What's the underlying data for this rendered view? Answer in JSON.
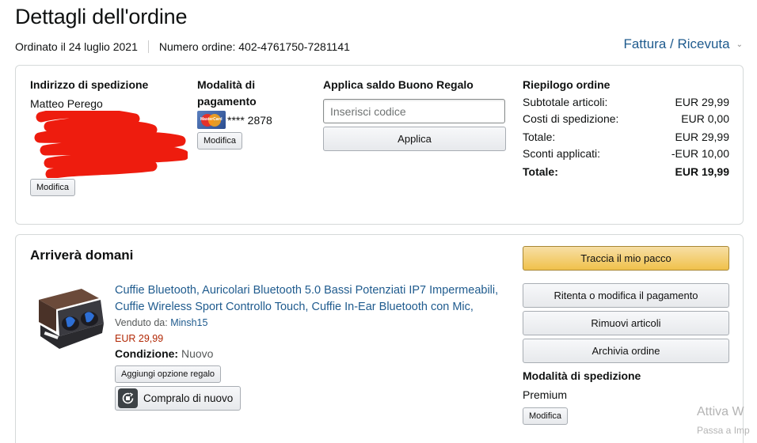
{
  "header": {
    "title": "Dettagli dell'ordine",
    "ordered_on": "Ordinato il 24 luglio 2021",
    "order_number": "Numero ordine: 402-4761750-7281141",
    "invoice_link": "Fattura / Ricevuta"
  },
  "shipping_address": {
    "heading": "Indirizzo di spedizione",
    "name": "Matteo Perego",
    "edit_button": "Modifica"
  },
  "payment": {
    "heading_line1": "Modalità di",
    "heading_line2": "pagamento",
    "card": "**** 2878",
    "card_brand_icon": "mastercard-icon",
    "edit_button": "Modifica"
  },
  "gift_card": {
    "heading": "Applica saldo Buono Regalo",
    "input_placeholder": "Inserisci codice",
    "input_value": "",
    "apply_button": "Applica"
  },
  "summary": {
    "heading": "Riepilogo ordine",
    "rows": [
      {
        "label": "Subtotale articoli:",
        "value": "EUR 29,99"
      },
      {
        "label": "Costi di spedizione:",
        "value": "EUR 0,00"
      },
      {
        "label": "Totale:",
        "value": "EUR 29,99"
      },
      {
        "label": "Sconti applicati:",
        "value": "-EUR 10,00"
      }
    ],
    "grand_total_label": "Totale:",
    "grand_total_value": "EUR 19,99"
  },
  "shipment": {
    "arrival": "Arriverà domani",
    "product": {
      "title_line1": "Cuffie Bluetooth, Auricolari Bluetooth 5.0 Bassi Potenziati IP7 Impermeabili,",
      "title_line2": "Cuffie Wireless Sport Controllo Touch, Cuffie In-Ear Bluetooth con Mic,",
      "sold_by_label": "Venduto da:",
      "seller": "Minsh15",
      "price": "EUR 29,99",
      "condition_label": "Condizione:",
      "condition_value": "Nuovo",
      "gift_button": "Aggiungi opzione regalo",
      "rebuy_button": "Compralo di nuovo"
    },
    "actions": {
      "track": "Traccia il mio pacco",
      "retry_payment": "Ritenta o modifica il pagamento",
      "remove_items": "Rimuovi articoli",
      "archive": "Archivia ordine"
    },
    "shipping_method": {
      "heading": "Modalità di spedizione",
      "value": "Premium",
      "edit_button": "Modifica"
    }
  },
  "os_watermark": {
    "line1": "Attiva W",
    "line2": "Passa a Imp"
  },
  "colors": {
    "link": "#1f5b8e",
    "price": "#b12704",
    "primary_button": "#f0c14b",
    "redaction": "#ee1c0e"
  }
}
